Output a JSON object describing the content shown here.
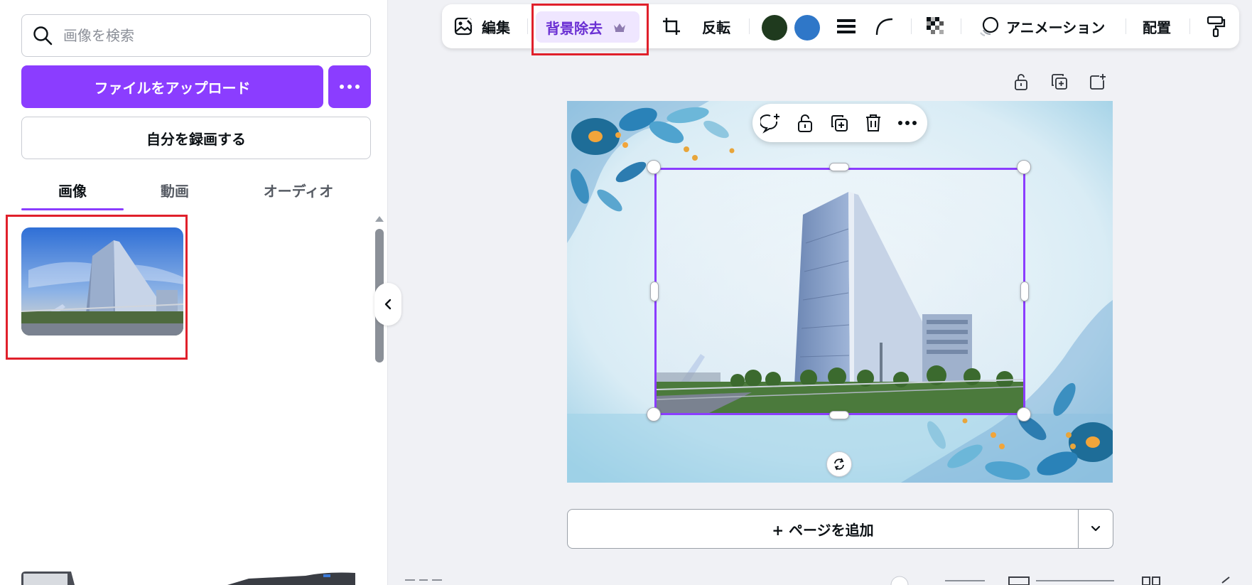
{
  "search": {
    "placeholder": "画像を検索"
  },
  "upload": {
    "label": "ファイルをアップロード"
  },
  "record": {
    "label": "自分を録画する"
  },
  "tabs": [
    {
      "label": "画像",
      "active": true
    },
    {
      "label": "動画",
      "active": false
    },
    {
      "label": "オーディオ",
      "active": false
    }
  ],
  "toolbar": {
    "edit_label": "編集",
    "bg_remove_label": "背景除去",
    "flip_label": "反転",
    "animation_label": "アニメーション",
    "position_label": "配置",
    "colors": [
      "#1f3a1e",
      "#2f77c8"
    ]
  },
  "canvas": {
    "add_page_label": "+ ページを追加"
  },
  "icons": {
    "search": "search-icon",
    "more": "more-dots-icon",
    "edit": "image-edit-icon",
    "premium": "crown-icon",
    "crop": "crop-icon",
    "border_style": "line-weight-icon",
    "corner": "corner-rounding-icon",
    "transparency": "transparency-icon",
    "animation": "animation-icon",
    "paint": "paint-roller-icon",
    "lock": "lock-icon",
    "duplicate": "duplicate-icon",
    "add_page": "add-page-icon",
    "comment": "add-comment-icon",
    "delete": "trash-icon",
    "rotate": "rotate-icon",
    "collapse": "chevron-left-icon",
    "dropdown": "chevron-down-icon"
  },
  "accent": "#8b3dff"
}
